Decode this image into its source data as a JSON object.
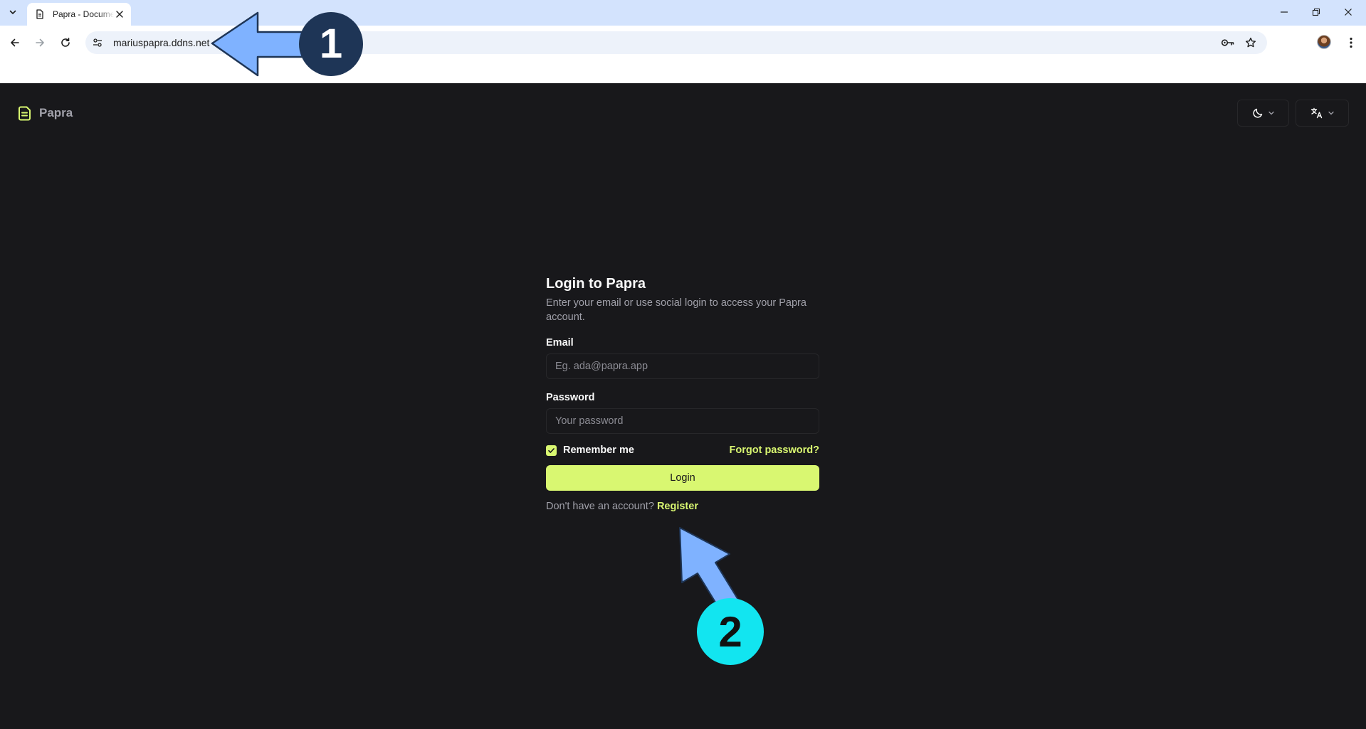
{
  "browser": {
    "tab_title": "Papra - Documents",
    "url": "mariuspapra.ddns.net",
    "icons": [
      "tab-list-icon",
      "document-favicon-icon",
      "close-icon",
      "minimize-icon",
      "restore-icon",
      "window-close-icon",
      "back-icon",
      "forward-icon",
      "reload-icon",
      "site-info-icon",
      "password-key-icon",
      "bookmark-star-icon",
      "profile-avatar",
      "more-menu-icon"
    ]
  },
  "app": {
    "brand": "Papra",
    "theme_icon": "moon-icon",
    "language_icon": "translate-icon"
  },
  "login": {
    "title": "Login to Papra",
    "subtitle": "Enter your email or use social login to access your Papra account.",
    "email_label": "Email",
    "email_placeholder": "Eg. ada@papra.app",
    "password_label": "Password",
    "password_placeholder": "Your password",
    "remember_label": "Remember me",
    "remember_checked": true,
    "forgot_link": "Forgot password?",
    "submit": "Login",
    "no_account_text": "Don't have an account?",
    "register_link": "Register"
  },
  "annotations": {
    "step1": "1",
    "step2": "2"
  },
  "colors": {
    "accent": "#d9f771",
    "background": "#18181b",
    "border": "#27272a",
    "annotation_arrow": "#7fb2ff",
    "step1_badge": "#1e3556",
    "step2_badge": "#12e5f0"
  }
}
